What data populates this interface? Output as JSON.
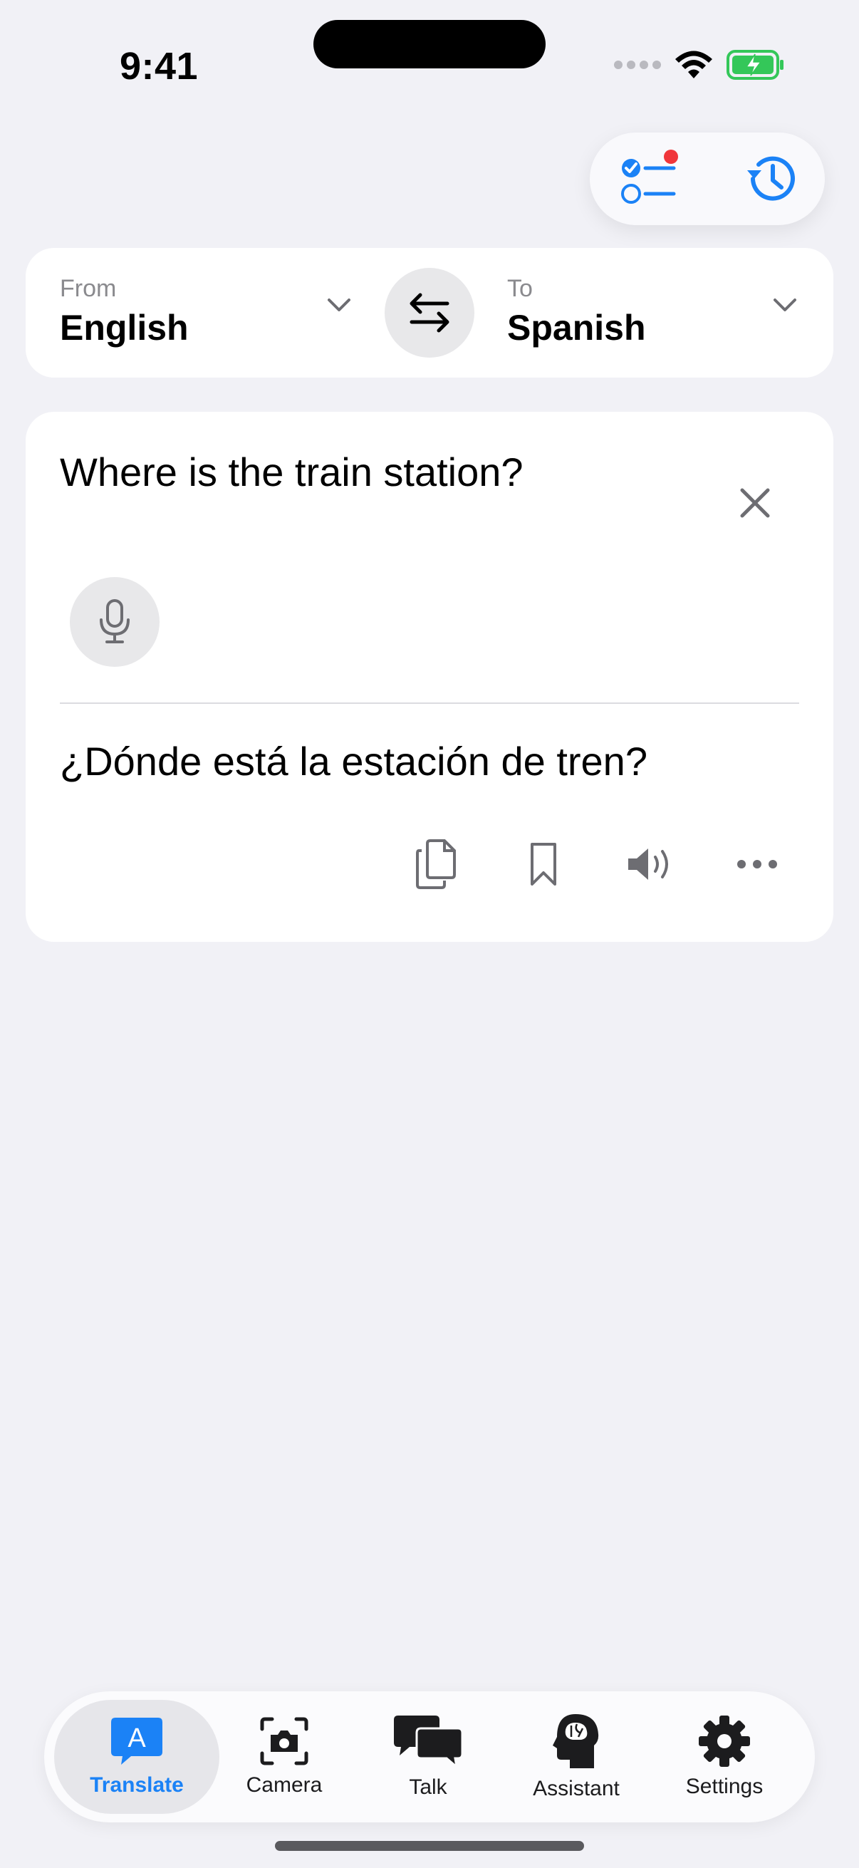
{
  "status_bar": {
    "time": "9:41"
  },
  "header": {
    "icons": [
      "task-list-icon",
      "history-icon"
    ],
    "accent_color": "#1b82f6",
    "badge_color": "#f0363b"
  },
  "language_selector": {
    "from_caption": "From",
    "from_language": "English",
    "to_caption": "To",
    "to_language": "Spanish"
  },
  "translation": {
    "source_text": "Where is the train station?",
    "translated_text": "¿Dónde está la estación de tren?"
  },
  "tabs": [
    {
      "label": "Translate",
      "icon": "translate-icon",
      "active": true
    },
    {
      "label": "Camera",
      "icon": "camera-icon",
      "active": false
    },
    {
      "label": "Talk",
      "icon": "chat-bubbles-icon",
      "active": false
    },
    {
      "label": "Assistant",
      "icon": "brain-head-icon",
      "active": false
    },
    {
      "label": "Settings",
      "icon": "gear-icon",
      "active": false
    }
  ]
}
